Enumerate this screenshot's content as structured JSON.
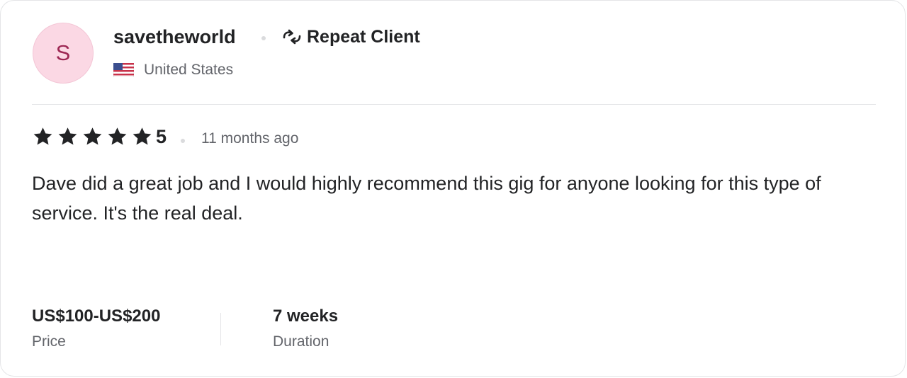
{
  "reviewer": {
    "avatar_letter": "S",
    "username": "savetheworld",
    "badge_label": "Repeat Client",
    "badge_icon": "repeat-icon",
    "country": "United States",
    "flag_icon": "us-flag-icon"
  },
  "rating": {
    "stars": 5,
    "score": "5",
    "time_ago": "11 months ago"
  },
  "review": {
    "text": "Dave did a great job and I would highly recommend this gig for anyone looking for this type of service. It's the real deal."
  },
  "details": {
    "price_value": "US$100-US$200",
    "price_label": "Price",
    "duration_value": "7 weeks",
    "duration_label": "Duration"
  },
  "colors": {
    "avatar_bg": "#fbd8e4",
    "avatar_text": "#9d2753",
    "text_primary": "#222325",
    "text_secondary": "#62646a"
  }
}
